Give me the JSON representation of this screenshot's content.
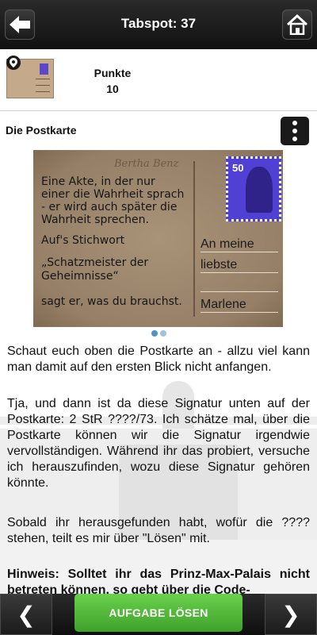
{
  "header": {
    "title": "Tabspot: 37"
  },
  "points": {
    "label": "Punkte",
    "value": "10"
  },
  "section": {
    "title": "Die Postkarte"
  },
  "postcard": {
    "signature_name": "Bertha Benz",
    "left_lines": [
      "Eine Akte, in der nur",
      "einer die Wahrheit sprach",
      "- er wird auch später die",
      "Wahrheit sprechen.",
      "Auf's Stichwort",
      "„Schatzmeister der",
      "Geheimnisse“",
      "sagt er, was du brauchst."
    ],
    "stamp_value": "50",
    "address_lines": [
      "An meine",
      "liebste",
      "Marlene"
    ]
  },
  "carousel": {
    "pages": 2,
    "active": 1
  },
  "body": {
    "p1": "Schaut euch oben die Postkarte an - allzu viel kann man damit auf den ersten Blick nicht anfangen.",
    "p2": "Tja, und dann ist da diese Signatur unten auf der Postkarte: 2 StR ????/73. Ich schätze mal, über die Postkarte können wir die Signatur irgendwie vervollständigen. Während ihr das probiert, versuche ich herauszufinden, wozu diese Signatur gehören könnte.",
    "p3": "Sobald ihr herausgefunden habt, wofür die ???? stehen, teilt es mir über \"Lösen\" mit.",
    "p4": "Hinweis: Solltet ihr das Prinz-Max-Palais nicht betreten können, so gebt über die Code-"
  },
  "footer": {
    "prev": "❮",
    "solve": "AUFGABE LÖSEN",
    "next": "❯"
  },
  "colors": {
    "solve_green": "#4cb232",
    "stamp_blue": "#5140d4",
    "postcard": "#957f66",
    "bar_dark": "#1a1a1a"
  }
}
